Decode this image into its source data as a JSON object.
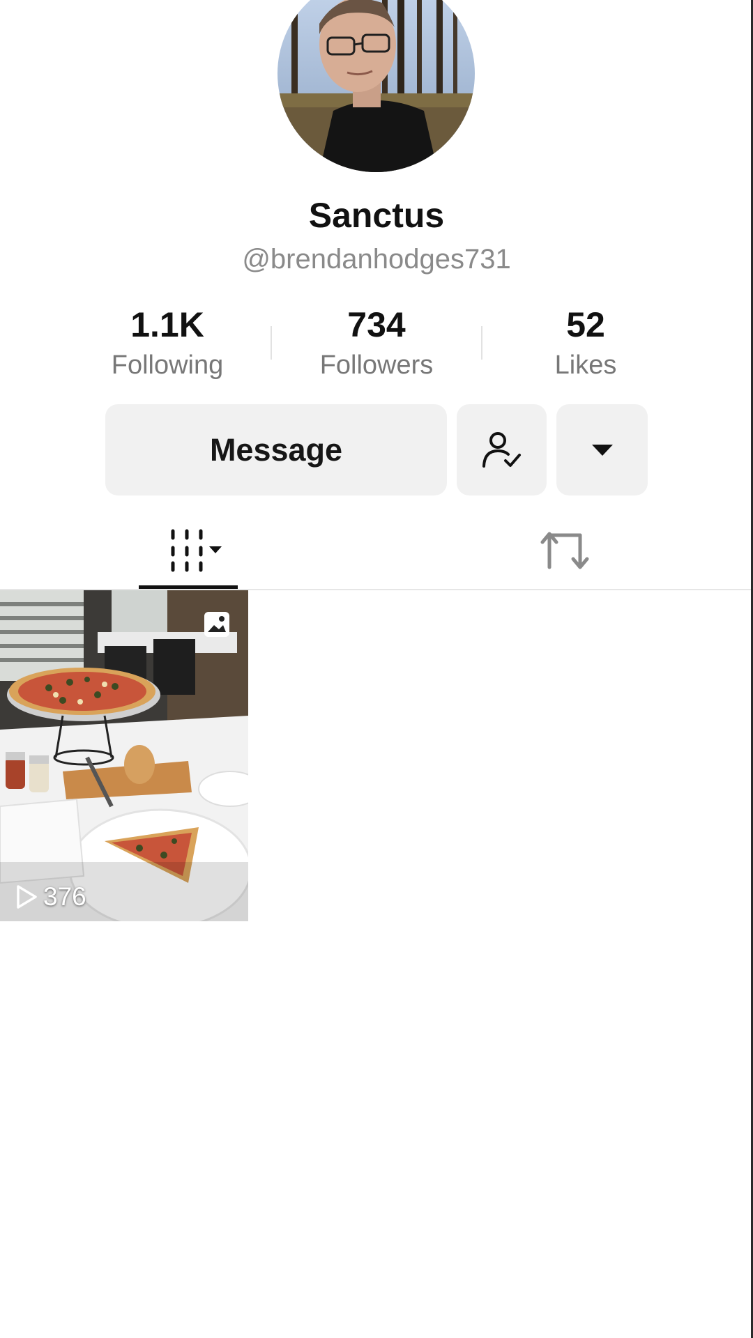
{
  "profile": {
    "display_name": "Sanctus",
    "handle": "@brendanhodges731",
    "avatar_icon": "profile-photo"
  },
  "stats": [
    {
      "value": "1.1K",
      "label": "Following"
    },
    {
      "value": "734",
      "label": "Followers"
    },
    {
      "value": "52",
      "label": "Likes"
    }
  ],
  "actions": {
    "message_label": "Message",
    "follow_icon": "user-check-icon",
    "more_icon": "caret-down-icon"
  },
  "tabs": [
    {
      "name": "videos",
      "icon": "grid-columns-icon",
      "selected": true
    },
    {
      "name": "reposts",
      "icon": "repost-icon",
      "selected": false
    }
  ],
  "posts": [
    {
      "type": "photo",
      "views": "376",
      "badge_icon": "photo-badge-icon",
      "play_icon": "play-outline-icon"
    }
  ],
  "colors": {
    "text_primary": "#111111",
    "text_secondary": "#8a8a8a",
    "button_bg": "#f1f1f1",
    "divider": "#e6e6e6"
  }
}
